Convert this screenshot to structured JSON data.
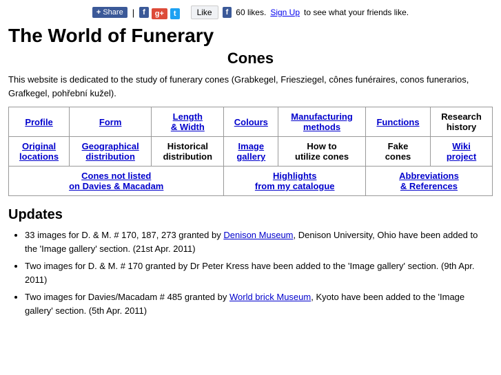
{
  "header": {
    "share_label": "Share",
    "like_label": "Like",
    "like_count": "60 likes.",
    "signup_text": "Sign Up",
    "like_suffix": "to see what your friends like."
  },
  "site_title": "The World of Funerary",
  "page_subtitle": "Cones",
  "intro": "This website is dedicated to the study of funerary cones (Grabkegel, Friesziegel, cônes funéraires, conos funerarios, Grafkegel, pohřební kužel).",
  "nav_rows": [
    [
      {
        "text": "Profile",
        "link": true,
        "colspan": 1,
        "rowspan": 1
      },
      {
        "text": "Form",
        "link": true,
        "colspan": 1,
        "rowspan": 1
      },
      {
        "text": "Length & Width",
        "link": true,
        "colspan": 1,
        "rowspan": 1
      },
      {
        "text": "Colours",
        "link": true,
        "colspan": 1,
        "rowspan": 1
      },
      {
        "text": "Manufacturing methods",
        "link": true,
        "colspan": 1,
        "rowspan": 1
      },
      {
        "text": "Functions",
        "link": true,
        "colspan": 1,
        "rowspan": 1
      },
      {
        "text": "Research history",
        "link": false,
        "colspan": 1,
        "rowspan": 1
      }
    ],
    [
      {
        "text": "Original locations",
        "link": true,
        "colspan": 1,
        "rowspan": 1
      },
      {
        "text": "Geographical distribution",
        "link": true,
        "colspan": 1,
        "rowspan": 1
      },
      {
        "text": "Historical distribution",
        "link": false,
        "colspan": 1,
        "rowspan": 1
      },
      {
        "text": "Image gallery",
        "link": true,
        "colspan": 1,
        "rowspan": 1
      },
      {
        "text": "How to utilize cones",
        "link": false,
        "colspan": 1,
        "rowspan": 1
      },
      {
        "text": "Fake cones",
        "link": false,
        "colspan": 1,
        "rowspan": 1
      },
      {
        "text": "Wiki project",
        "link": true,
        "colspan": 1,
        "rowspan": 1
      }
    ],
    [
      {
        "text": "Cones not listed on Davies & Macadam",
        "link": true,
        "colspan": 3,
        "rowspan": 1
      },
      {
        "text": "Highlights from my catalogue",
        "link": true,
        "colspan": 2,
        "rowspan": 1
      },
      {
        "text": "Abbreviations & References",
        "link": true,
        "colspan": 2,
        "rowspan": 1
      }
    ]
  ],
  "updates_title": "Updates",
  "updates": [
    {
      "text": "33 images for D. & M. # 170, 187, 273 granted by ",
      "link_text": "Denison Museum",
      "link_after": ", Denison University, Ohio have been added to the 'Image gallery' section. (21st Apr. 2011)"
    },
    {
      "text": "Two images for D. & M. # 170 granted by Dr Peter Kress have been added to the 'Image gallery' section. (9th Apr. 2011)",
      "link_text": "",
      "link_after": ""
    },
    {
      "text": "Two images for Davies/Macadam # 485 granted by ",
      "link_text": "World brick Museum",
      "link_after": ", Kyoto have been added to the 'Image gallery' section. (5th Apr. 2011)"
    }
  ]
}
